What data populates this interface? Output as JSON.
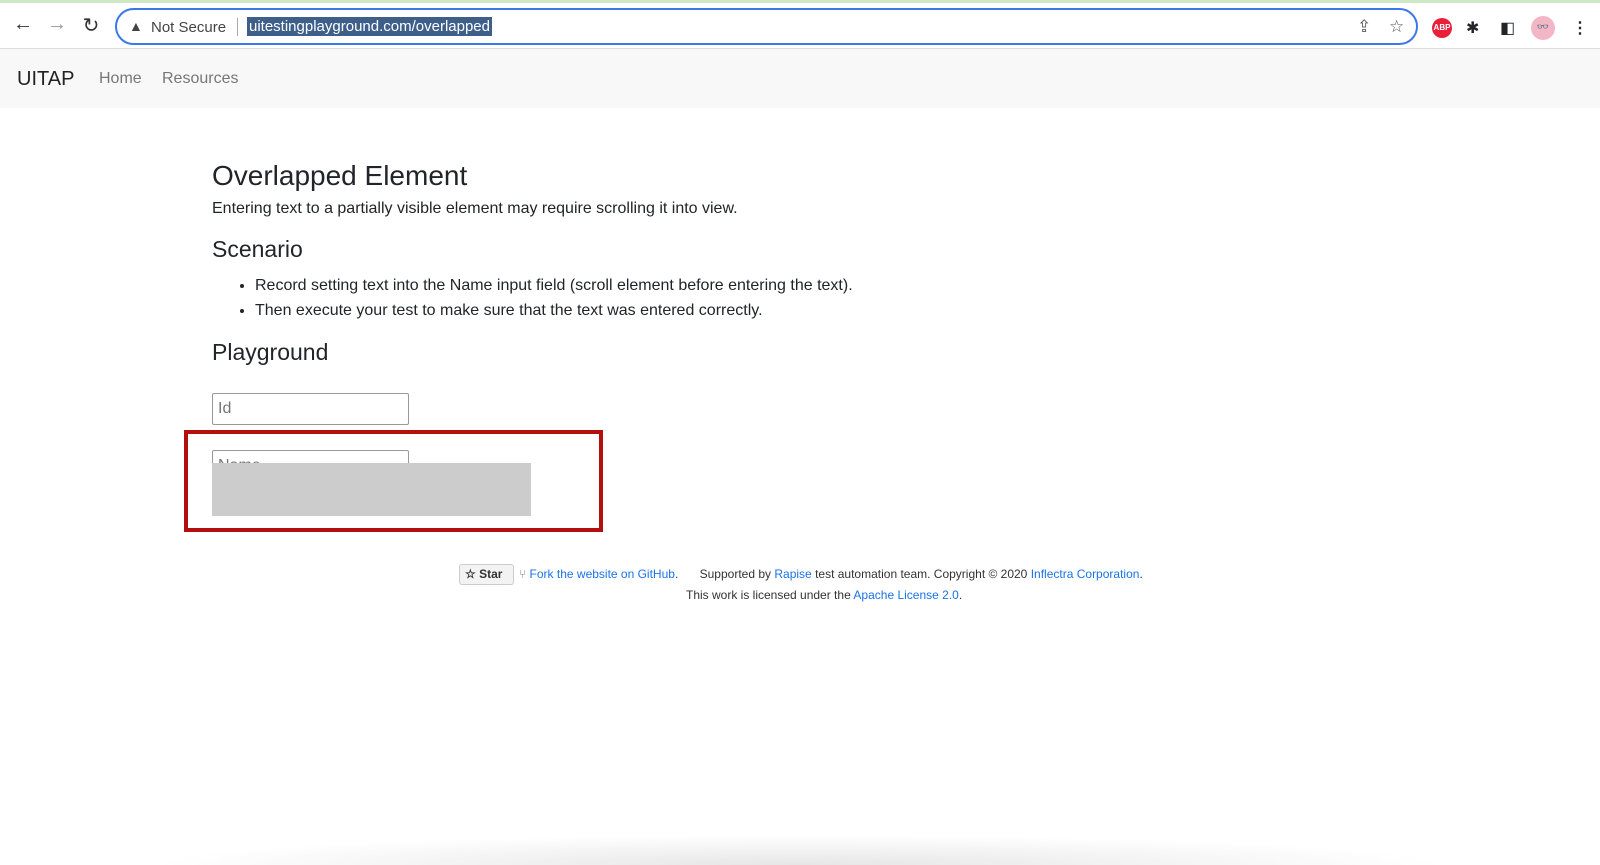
{
  "browser": {
    "security_label": "Not Secure",
    "url": "uitestingplayground.com/overlapped",
    "abp_label": "ABP"
  },
  "nav": {
    "brand": "UITAP",
    "links": [
      "Home",
      "Resources"
    ]
  },
  "page": {
    "title": "Overlapped Element",
    "description": "Entering text to a partially visible element may require scrolling it into view.",
    "scenario_heading": "Scenario",
    "scenario_items": [
      "Record setting text into the Name input field (scroll element before entering the text).",
      "Then execute your test to make sure that the text was entered correctly."
    ],
    "playground_heading": "Playground",
    "id_placeholder": "Id",
    "name_placeholder": "Name"
  },
  "footer": {
    "star_label": "Star",
    "fork_link": "Fork the website on GitHub",
    "supported_by": "Supported by",
    "rapise_link": "Rapise",
    "copyright": "test automation team. Copyright © 2020",
    "inflectra_link": "Inflectra Corporation",
    "license_text": "This work is licensed under the",
    "license_link": "Apache License 2.0"
  },
  "colors": {
    "highlight": "#b30f0f",
    "overlay": "#cccccc",
    "link": "#1a73e8"
  }
}
